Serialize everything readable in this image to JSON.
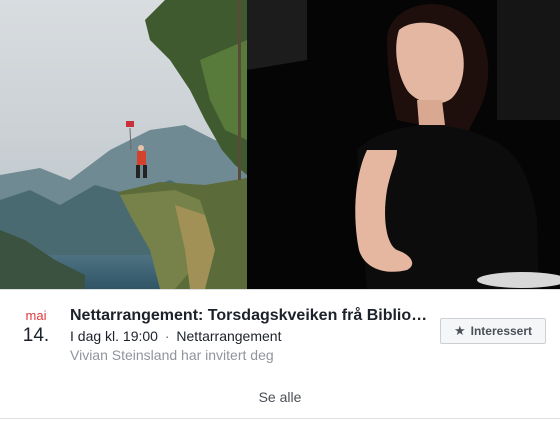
{
  "event": {
    "month": "mai",
    "day": "14.",
    "title": "Nettarrangement: Torsdagskveiken frå Bibliotek...",
    "time": "I dag kl. 19:00",
    "separator": "·",
    "location": "Nettarrangement",
    "invited_by": "Vivian Steinsland har invitert deg",
    "interested_label": "Interessert",
    "interested_icon": "star-icon"
  },
  "footer": {
    "see_all_label": "Se alle"
  },
  "colors": {
    "month_red": "#e0393e",
    "text_dark": "#1d2129",
    "text_muted": "#90949c",
    "button_bg": "#f5f6f7"
  }
}
